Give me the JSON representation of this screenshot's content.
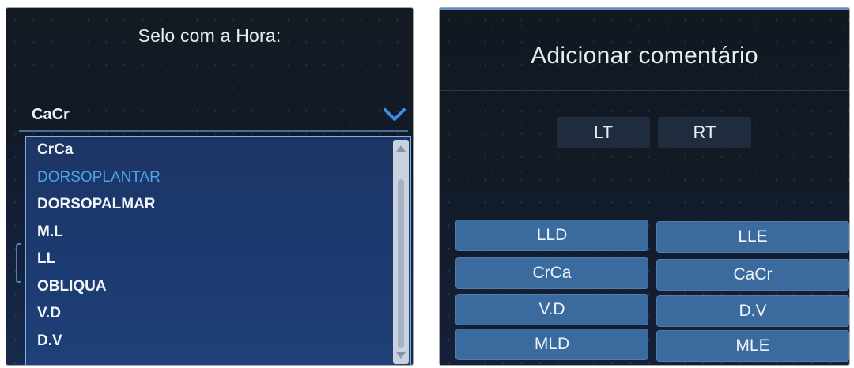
{
  "left_panel": {
    "title": "Selo com a Hora:",
    "combo_value": "CaCr",
    "options": [
      {
        "label": "CrCa",
        "selected": false
      },
      {
        "label": "DORSOPLANTAR",
        "selected": true
      },
      {
        "label": "DORSOPALMAR",
        "selected": false
      },
      {
        "label": "M.L",
        "selected": false
      },
      {
        "label": "LL",
        "selected": false
      },
      {
        "label": "OBLIQUA",
        "selected": false
      },
      {
        "label": "V.D",
        "selected": false
      },
      {
        "label": "D.V",
        "selected": false
      }
    ]
  },
  "right_panel": {
    "title": "Adicionar comentário",
    "side_buttons": [
      "LT",
      "RT"
    ],
    "grid_buttons": [
      [
        "LLD",
        "LLE"
      ],
      [
        "CrCa",
        "CaCr"
      ],
      [
        "V.D",
        "D.V"
      ],
      [
        "MLD",
        "MLE"
      ]
    ]
  },
  "colors": {
    "selected_option": "#4ea2ef",
    "grid_button": "#3b6a9e",
    "dropdown_border": "#7fb0e6"
  },
  "icons": [
    "chevron-down-icon",
    "scroll-up-icon",
    "scroll-down-icon"
  ]
}
